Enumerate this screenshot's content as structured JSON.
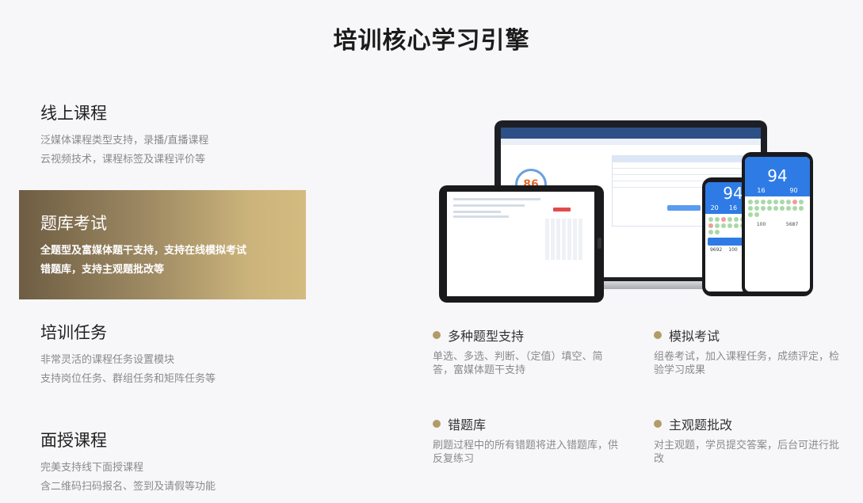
{
  "page": {
    "title": "培训核心学习引擎"
  },
  "menu": [
    {
      "title": "线上课程",
      "desc1": "泛媒体课程类型支持，录播/直播课程",
      "desc2": "云视频技术，课程标签及课程评价等"
    },
    {
      "title": "题库考试",
      "desc1": "全题型及富媒体题干支持，支持在线模拟考试",
      "desc2": "错题库，支持主观题批改等"
    },
    {
      "title": "培训任务",
      "desc1": "非常灵活的课程任务设置模块",
      "desc2": "支持岗位任务、群组任务和矩阵任务等"
    },
    {
      "title": "面授课程",
      "desc1": "完美支持线下面授课程",
      "desc2": "含二维码扫码报名、签到及请假等功能"
    }
  ],
  "devices": {
    "laptop_score": "86",
    "phone_score": "94",
    "phone_stats": [
      "20",
      "16",
      "90"
    ],
    "phone_foot": [
      "9692",
      "100",
      "5687"
    ]
  },
  "features": [
    {
      "title": "多种题型支持",
      "desc": "单选、多选、判断、（定值）填空、简答，富媒体题干支持"
    },
    {
      "title": "模拟考试",
      "desc": "组卷考试，加入课程任务，成绩评定，检验学习成果"
    },
    {
      "title": "错题库",
      "desc": "刷题过程中的所有错题将进入错题库，供反复练习"
    },
    {
      "title": "主观题批改",
      "desc": "对主观题，学员提交答案，后台可进行批改"
    }
  ],
  "colors": {
    "accent": "#b39b69",
    "active_gradient_start": "#6e5d43",
    "active_gradient_end": "#d3bb80"
  }
}
